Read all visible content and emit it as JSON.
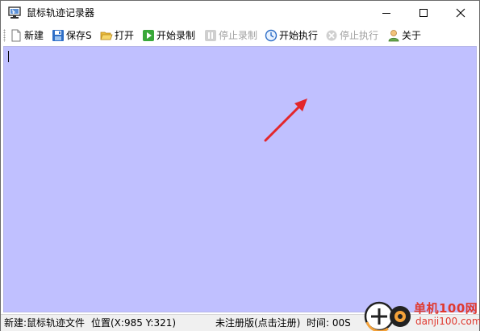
{
  "window": {
    "title": "鼠标轨迹记录器",
    "icon": "monitor-app-icon"
  },
  "titlebar_buttons": {
    "minimize_icon": "minimize-icon",
    "maximize_icon": "maximize-icon",
    "close_icon": "close-icon"
  },
  "toolbar": {
    "items": [
      {
        "label": "新建",
        "icon": "new-file-icon",
        "enabled": true
      },
      {
        "label": "保存S",
        "icon": "save-disk-icon",
        "enabled": true
      },
      {
        "label": "打开",
        "icon": "open-folder-icon",
        "enabled": true
      },
      {
        "label": "开始录制",
        "icon": "play-record-icon",
        "enabled": true
      },
      {
        "label": "停止录制",
        "icon": "pause-icon",
        "enabled": false
      },
      {
        "label": "开始执行",
        "icon": "clock-icon",
        "enabled": true
      },
      {
        "label": "停止执行",
        "icon": "stop-circle-icon",
        "enabled": false
      },
      {
        "label": "关于",
        "icon": "user-icon",
        "enabled": true
      }
    ]
  },
  "canvas": {
    "background_color": "#c0c0ff",
    "annotation": "red-arrow-pointing-to-start-execute"
  },
  "statusbar": {
    "file_status": "新建:鼠标轨迹文件",
    "position": "位置(X:985 Y:321)",
    "registration": "未注册版(点击注册)",
    "time": "时间:  00S"
  },
  "watermark": {
    "text_cn": "单机100网",
    "text_url": "danji100.com",
    "color": "#e0392f"
  },
  "colors": {
    "accent_red": "#e0392f",
    "canvas": "#c0c0ff",
    "disabled_text": "#a0a0a0"
  }
}
